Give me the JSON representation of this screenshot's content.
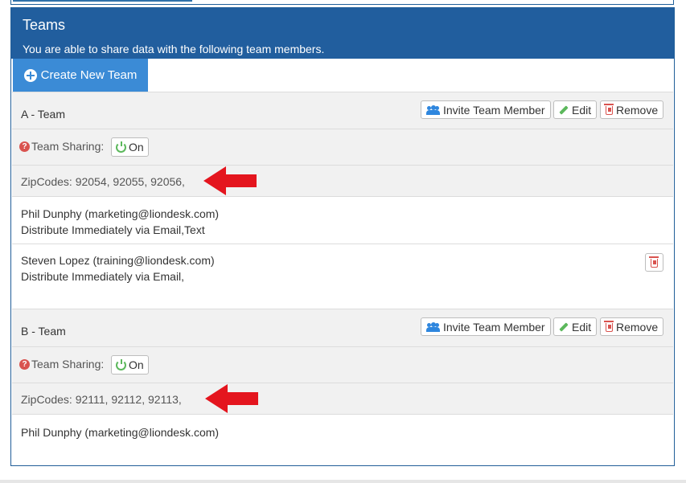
{
  "panel": {
    "title": "Teams",
    "subtitle": "You are able to share data with the following team members.",
    "create_button": "Create New Team",
    "header_color": "#215e9e",
    "button_color": "#3b8bd6"
  },
  "actions": {
    "invite": "Invite Team Member",
    "edit": "Edit",
    "remove": "Remove"
  },
  "sharing": {
    "label": "Team Sharing:",
    "state": "On"
  },
  "teams": [
    {
      "name": "A - Team",
      "zipcodes": "ZipCodes: 92054, 92055, 92056,",
      "members": [
        {
          "line1": "Phil Dunphy (marketing@liondesk.com)",
          "line2": "Distribute Immediately via Email,Text"
        },
        {
          "line1": "Steven Lopez (training@liondesk.com)",
          "line2": "Distribute Immediately via Email,"
        }
      ]
    },
    {
      "name": "B - Team",
      "zipcodes": "ZipCodes: 92111, 92112, 92113,",
      "members": [
        {
          "line1": "Phil Dunphy (marketing@liondesk.com)"
        }
      ]
    }
  ],
  "icons": {
    "create": "plus-circle-icon",
    "invite": "users-icon",
    "edit": "pencil-icon",
    "remove": "trash-icon",
    "help": "question-circle-icon",
    "power": "power-icon",
    "annotation": "red-arrow"
  }
}
